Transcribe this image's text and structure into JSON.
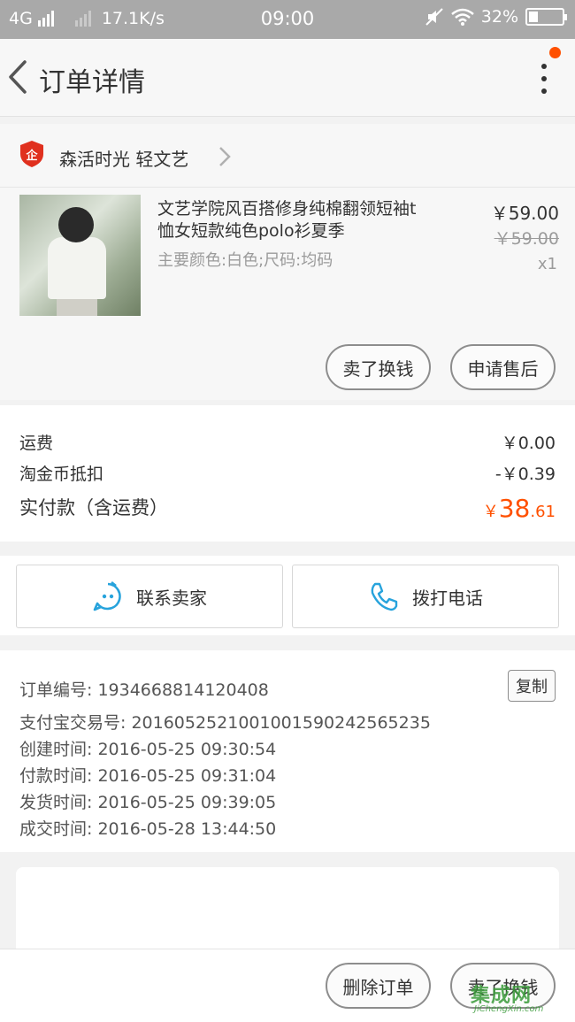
{
  "status_bar": {
    "network": "4G",
    "speed": "17.1K/s",
    "time": "09:00",
    "battery": "32%"
  },
  "nav": {
    "title": "订单详情"
  },
  "shop": {
    "name": "森活时光 轻文艺",
    "badge_text": "企"
  },
  "item": {
    "title": "文艺学院风百搭修身纯棉翻领短袖t恤女短款纯色polo衫夏季",
    "sku": "主要颜色:白色;尺码:均码",
    "price": "￥59.00",
    "original_price": "￥59.00",
    "quantity": "x1",
    "actions": {
      "resell": "卖了换钱",
      "after_sale": "申请售后"
    }
  },
  "costs": {
    "shipping_label": "运费",
    "shipping_value": "￥0.00",
    "coins_label": "淘金币抵扣",
    "coins_value": "-￥0.39",
    "total_label": "实付款（含运费）",
    "total_currency": "￥",
    "total_integer": "38",
    "total_decimal": ".61"
  },
  "contact": {
    "seller": "联系卖家",
    "phone": "拨打电话"
  },
  "order_info": {
    "order_no": "订单编号: 1934668814120408",
    "alipay_no": "支付宝交易号: 2016052521001001590242565235",
    "created": "创建时间: 2016-05-25 09:30:54",
    "paid": "付款时间: 2016-05-25 09:31:04",
    "shipped": "发货时间: 2016-05-25 09:39:05",
    "completed": "成交时间: 2016-05-28 13:44:50",
    "copy_label": "复制"
  },
  "bottom": {
    "delete": "删除订单",
    "resell": "卖了换钱"
  },
  "watermark": {
    "logo": "集成网",
    "url": "JiChengXin.com"
  },
  "colors": {
    "accent": "#ff5000",
    "icon_blue": "#27a3dc"
  }
}
